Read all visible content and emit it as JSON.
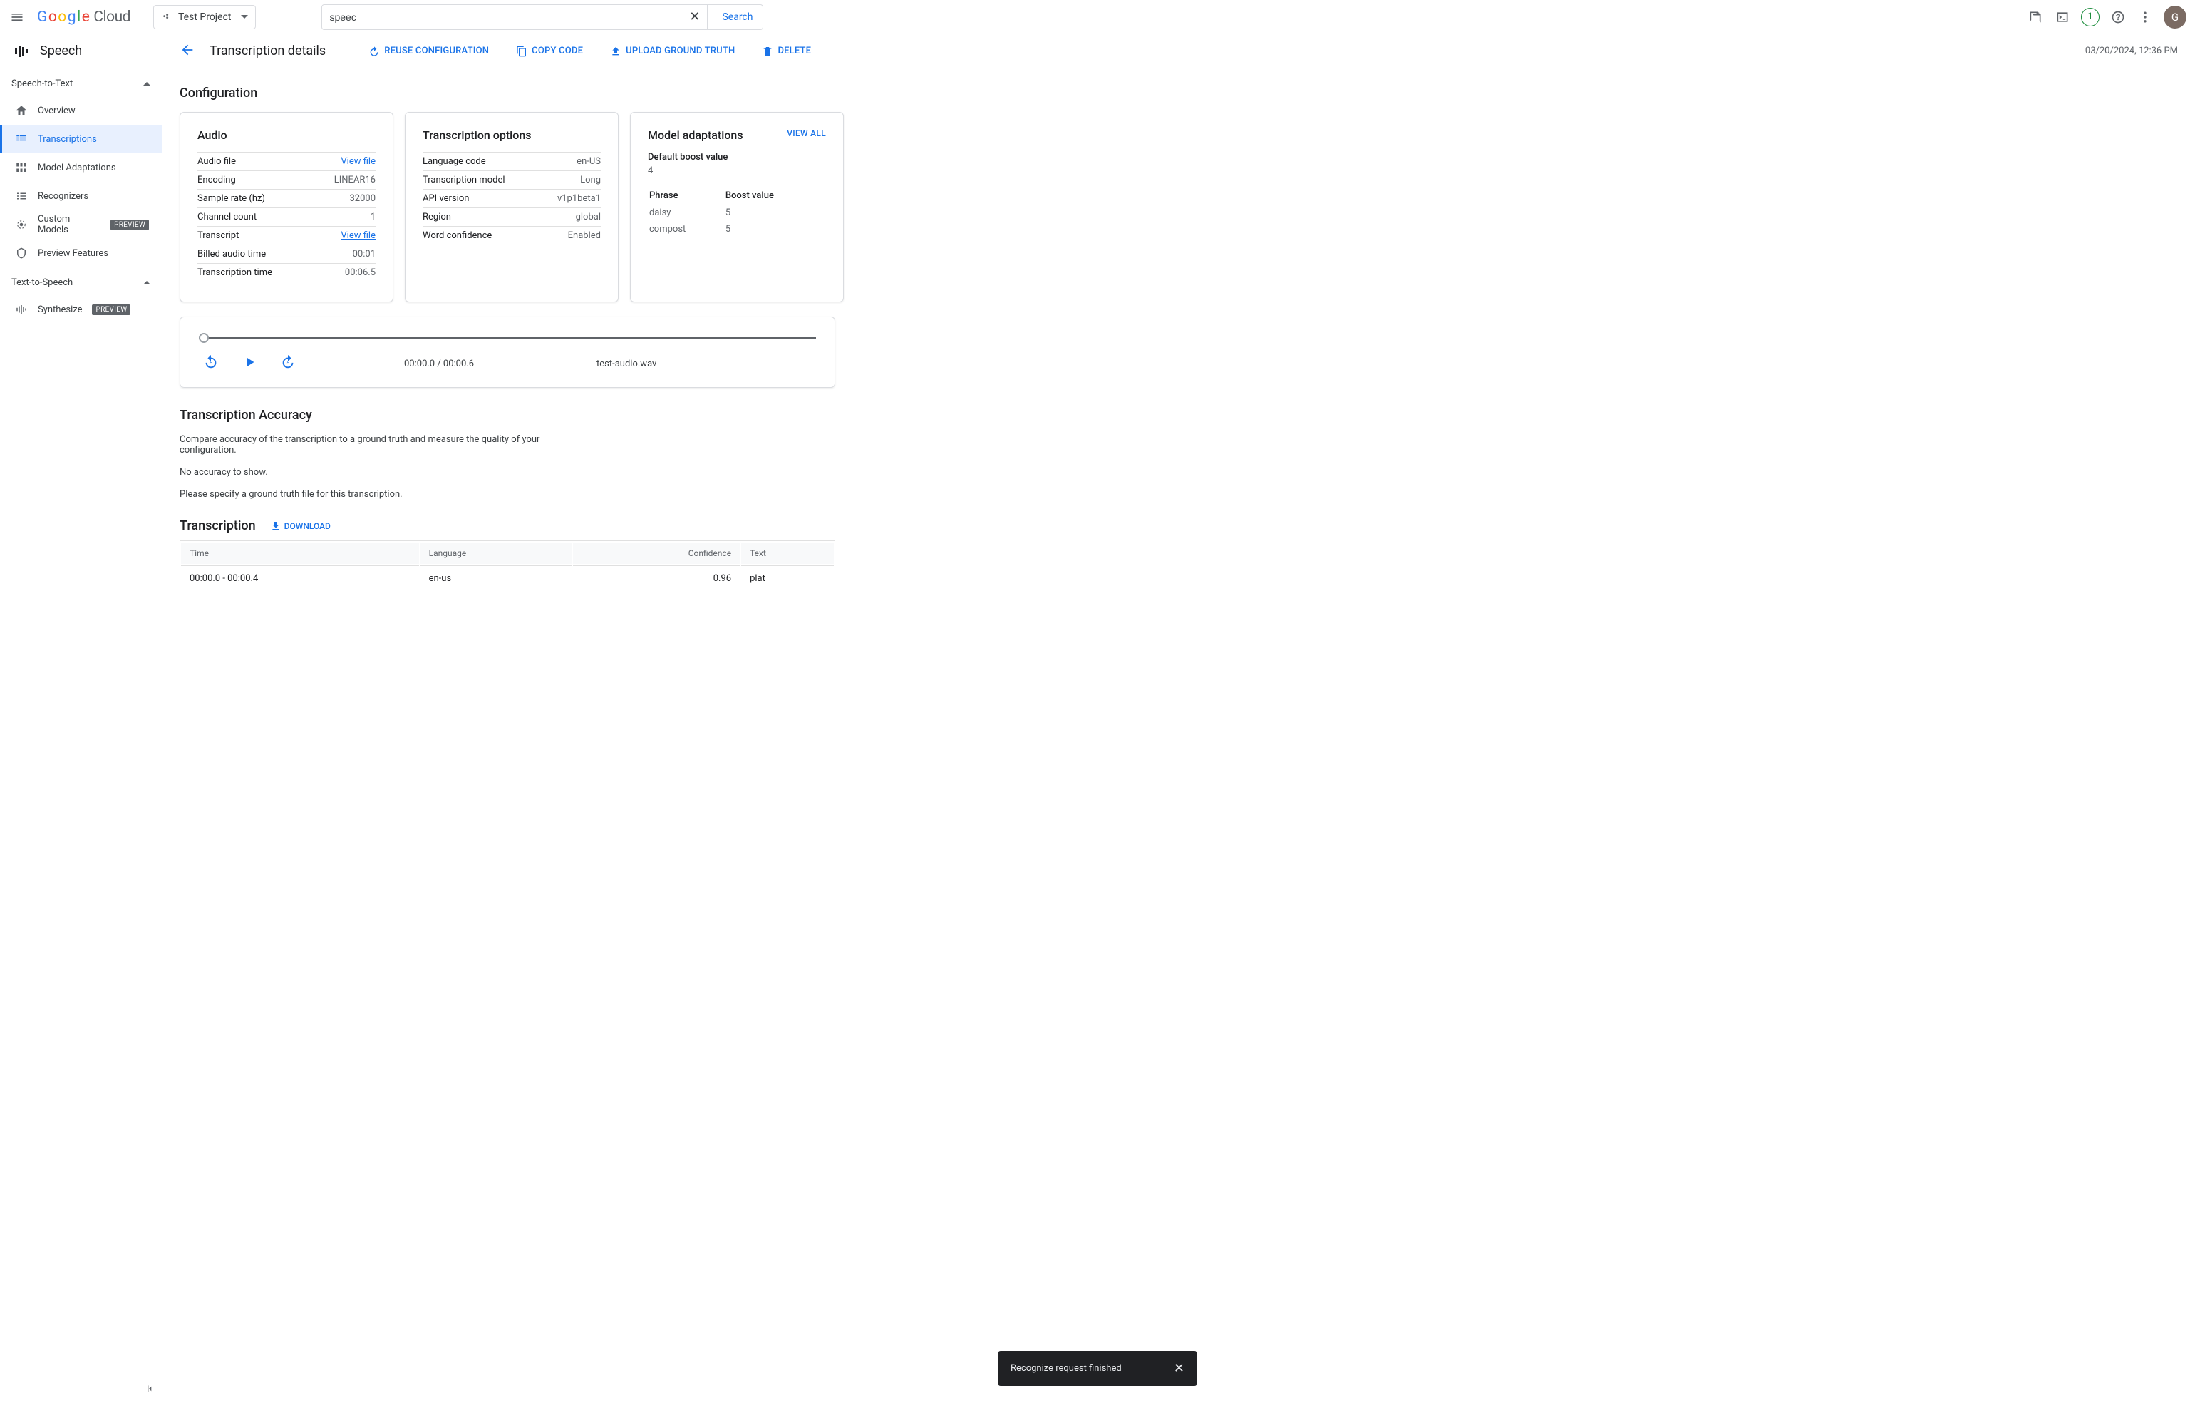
{
  "header": {
    "logo_cloud": "Cloud",
    "project": "Test Project",
    "search_value": "speec",
    "search_button": "Search",
    "trial_badge": "1",
    "avatar_letter": "G"
  },
  "sidebar": {
    "product": "Speech",
    "sections": {
      "stt": "Speech-to-Text",
      "tts": "Text-to-Speech"
    },
    "items": {
      "overview": "Overview",
      "transcriptions": "Transcriptions",
      "model_adaptations": "Model Adaptations",
      "recognizers": "Recognizers",
      "custom_models": "Custom Models",
      "preview_features": "Preview Features",
      "synthesize": "Synthesize"
    },
    "preview_badge": "PREVIEW"
  },
  "detail_header": {
    "title": "Transcription details",
    "reuse": "REUSE CONFIGURATION",
    "copy": "COPY CODE",
    "upload": "UPLOAD GROUND TRUTH",
    "delete": "DELETE",
    "timestamp": "03/20/2024, 12:36 PM"
  },
  "configuration": {
    "title": "Configuration",
    "audio": {
      "title": "Audio",
      "rows": {
        "audio_file": {
          "label": "Audio file",
          "link": "View file"
        },
        "encoding": {
          "label": "Encoding",
          "value": "LINEAR16"
        },
        "sample_rate": {
          "label": "Sample rate (hz)",
          "value": "32000"
        },
        "channel_count": {
          "label": "Channel count",
          "value": "1"
        },
        "transcript": {
          "label": "Transcript",
          "link": "View file"
        },
        "billed_time": {
          "label": "Billed audio time",
          "value": "00:01"
        },
        "transcription_time": {
          "label": "Transcription time",
          "value": "00:06.5"
        }
      }
    },
    "options": {
      "title": "Transcription options",
      "rows": {
        "language": {
          "label": "Language code",
          "value": "en-US"
        },
        "model": {
          "label": "Transcription model",
          "value": "Long"
        },
        "api": {
          "label": "API version",
          "value": "v1p1beta1"
        },
        "region": {
          "label": "Region",
          "value": "global"
        },
        "confidence": {
          "label": "Word confidence",
          "value": "Enabled"
        }
      }
    },
    "adaptations": {
      "title": "Model adaptations",
      "view_all": "VIEW ALL",
      "default_boost_label": "Default boost value",
      "default_boost_value": "4",
      "col_phrase": "Phrase",
      "col_boost": "Boost value",
      "rows": [
        {
          "phrase": "daisy",
          "boost": "5"
        },
        {
          "phrase": "compost",
          "boost": "5"
        }
      ]
    }
  },
  "player": {
    "time": "00:00.0 / 00:00.6",
    "filename": "test-audio.wav"
  },
  "accuracy": {
    "title": "Transcription Accuracy",
    "desc": "Compare accuracy of the transcription to a ground truth and measure the quality of your configuration.",
    "none": "No accuracy to show.",
    "hint": "Please specify a ground truth file for this transcription."
  },
  "transcription": {
    "title": "Transcription",
    "download": "DOWNLOAD",
    "cols": {
      "time": "Time",
      "language": "Language",
      "confidence": "Confidence",
      "text": "Text"
    },
    "rows": [
      {
        "time": "00:00.0 - 00:00.4",
        "language": "en-us",
        "confidence": "0.96",
        "text": "plat"
      }
    ]
  },
  "toast": {
    "message": "Recognize request finished"
  }
}
